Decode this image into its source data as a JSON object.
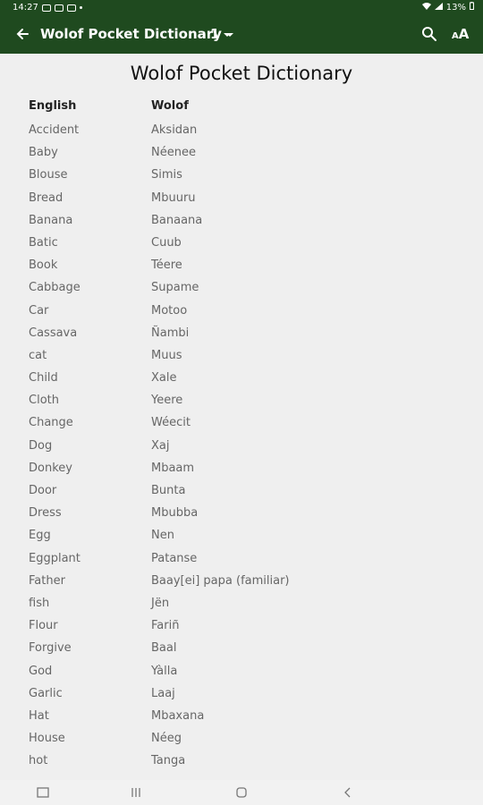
{
  "status_bar": {
    "time": "14:27",
    "battery": "13%"
  },
  "app_bar": {
    "title": "Wolof Pocket Dictionary",
    "page_number": "1"
  },
  "document": {
    "title": "Wolof Pocket Dictionary",
    "headers": {
      "english": "English",
      "wolof": "Wolof"
    },
    "entries": [
      {
        "english": "Accident",
        "wolof": "Aksidan"
      },
      {
        "english": "Baby",
        "wolof": "Néenee"
      },
      {
        "english": "Blouse",
        "wolof": "Simis"
      },
      {
        "english": "Bread",
        "wolof": "Mbuuru"
      },
      {
        "english": "Banana",
        "wolof": "Banaana"
      },
      {
        "english": "Batic",
        "wolof": "Cuub"
      },
      {
        "english": "Book",
        "wolof": "Téere"
      },
      {
        "english": "Cabbage",
        "wolof": "Supame"
      },
      {
        "english": "Car",
        "wolof": "Motoo"
      },
      {
        "english": "Cassava",
        "wolof": "Ñambi"
      },
      {
        "english": "cat",
        "wolof": "Muus"
      },
      {
        "english": "Child",
        "wolof": "Xale"
      },
      {
        "english": "Cloth",
        "wolof": "Yeere"
      },
      {
        "english": "Change",
        "wolof": "Wéecit"
      },
      {
        "english": "Dog",
        "wolof": "Xaj"
      },
      {
        "english": "Donkey",
        "wolof": "Mbaam"
      },
      {
        "english": "Door",
        "wolof": "Bunta"
      },
      {
        "english": "Dress",
        "wolof": "Mbubba"
      },
      {
        "english": "Egg",
        "wolof": "Nen"
      },
      {
        "english": "Eggplant",
        "wolof": "Patanse"
      },
      {
        "english": "Father",
        "wolof": "Baay[ei] papa (familiar)"
      },
      {
        "english": "fish",
        "wolof": "Jën"
      },
      {
        "english": "Flour",
        "wolof": "Fariñ"
      },
      {
        "english": "Forgive",
        "wolof": "Baal"
      },
      {
        "english": "God",
        "wolof": "Yàlla"
      },
      {
        "english": "Garlic",
        "wolof": "Laaj"
      },
      {
        "english": "Hat",
        "wolof": "Mbaxana"
      },
      {
        "english": "House",
        "wolof": "Néeg"
      },
      {
        "english": "hot",
        "wolof": "Tanga"
      }
    ]
  },
  "icons": {
    "back": "arrow-left-icon",
    "search": "search-icon",
    "font_size": "font-size-icon"
  },
  "colors": {
    "app_bar": "#1f4a1f",
    "background": "#efefef"
  }
}
